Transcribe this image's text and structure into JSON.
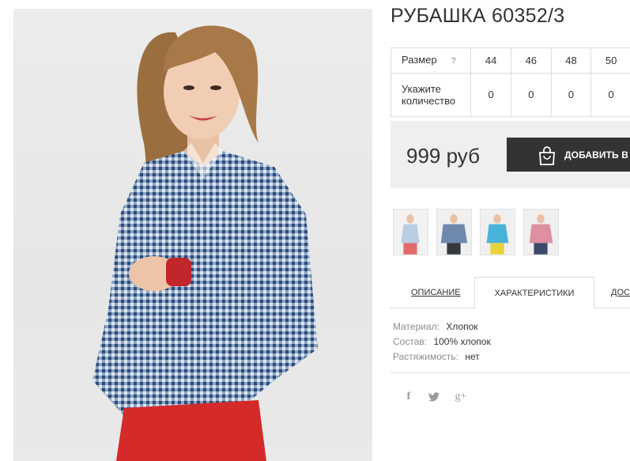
{
  "product": {
    "title": "РУБАШКА 60352/3",
    "price": "999 руб",
    "add_to_cart": "ДОБАВИТЬ В ЗА"
  },
  "size_table": {
    "size_label": "Размер",
    "help": "?",
    "sizes": [
      "44",
      "46",
      "48",
      "50"
    ],
    "qty_label_line1": "Укажите",
    "qty_label_line2": "количество",
    "quantities": [
      "0",
      "0",
      "0",
      "0"
    ]
  },
  "tabs": {
    "description": "ОПИСАНИЕ",
    "characteristics": "ХАРАКТЕРИСТИКИ",
    "delivery": "ДОСТ"
  },
  "specs": [
    {
      "key": "Материал:",
      "value": "Хлопок"
    },
    {
      "key": "Состав:",
      "value": "100% хлопок"
    },
    {
      "key": "Растяжимость:",
      "value": "нет"
    }
  ],
  "social": {
    "facebook": "f",
    "twitter": "t",
    "googleplus": "g+"
  },
  "colors": {
    "accent_dark": "#333333",
    "price_bg": "#efefef",
    "shirt_blue": "#5b7ca8",
    "pants_red": "#d42a2a"
  },
  "thumbnails": [
    {
      "icon": "thumbnail-light-blue-shirt"
    },
    {
      "icon": "thumbnail-blue-check-shirt"
    },
    {
      "icon": "thumbnail-turquoise-shirt"
    },
    {
      "icon": "thumbnail-pink-shirt"
    }
  ]
}
